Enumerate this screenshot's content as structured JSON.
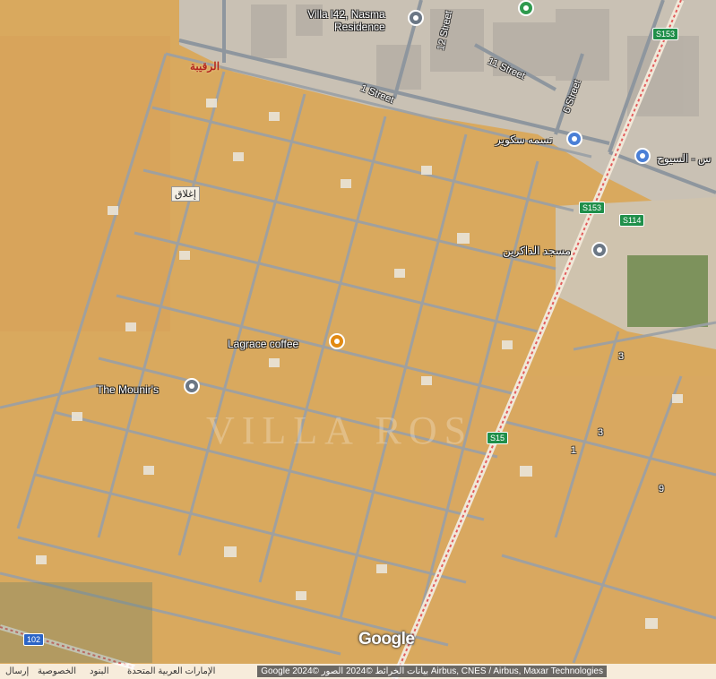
{
  "labels": {
    "villa_l42": "Villa l42, Nasma",
    "villa_l42_line2": "Residence",
    "nasma_square": "نسمه سكوير",
    "suyoh": "س - السيوح",
    "dhakreen_mosque": "مسجد الذاكرين",
    "lagrace": "Lagrace coffee",
    "mounirs": "The Mounir's",
    "closed_tag": "إغلاق",
    "ruqaiba": "الرقيبة"
  },
  "streets": {
    "s12": "12 Street",
    "s11": "11 Street",
    "s6": "6 Street",
    "s1": "1 Street",
    "n3a": "3",
    "n3b": "3",
    "n1": "1",
    "n9": "9"
  },
  "shields": {
    "s153_top": "S153",
    "s153_mid": "S153",
    "s114": "S114",
    "s15_low": "S15",
    "r102": "102"
  },
  "watermark": "VILLA ROS",
  "google_logo": "Google",
  "footer": {
    "send": "إرسال",
    "privacy": "الخصوصية",
    "terms": "البنود",
    "country": "الإمارات العربية المتحدة",
    "attribution": "Google بيانات الخرائط ©2024 الصور ©2024 Airbus, CNES / Airbus, Maxar Technologies"
  },
  "colors": {
    "sand": "#d9a95e",
    "road": "#9aa0a6",
    "highway": "#e25b5b",
    "urban": "#c9c1b4"
  },
  "icons": {
    "villa_pin": "location-pin-icon",
    "park_pin": "tree-icon",
    "shopping_pin": "shopping-bag-icon",
    "mosque_pin": "mosque-icon",
    "coffee_pin": "coffee-cup-icon",
    "mounirs_pin": "location-pin-icon"
  }
}
